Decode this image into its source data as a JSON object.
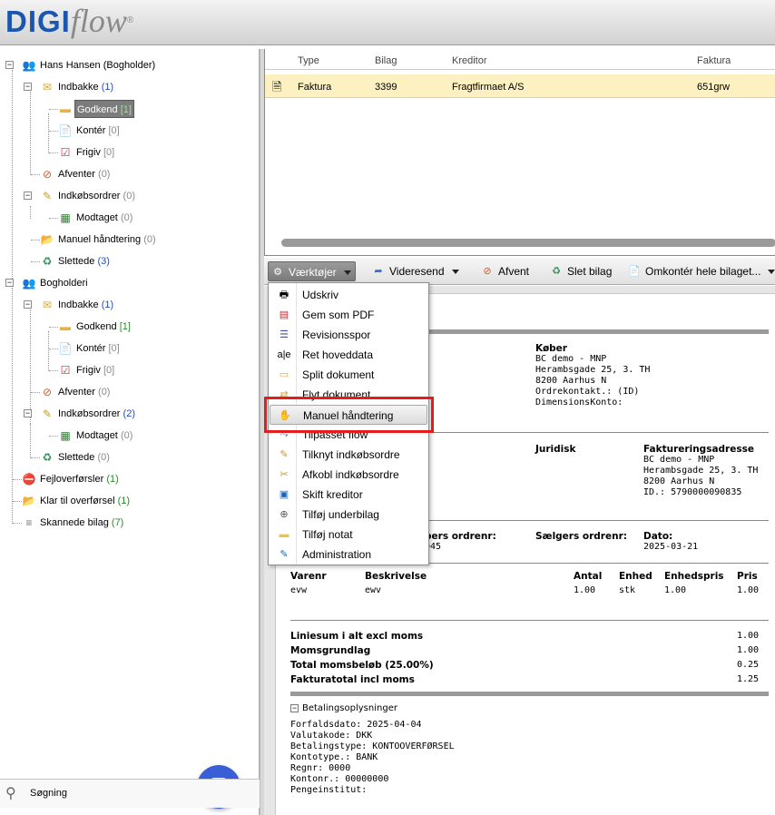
{
  "app": {
    "logo_a": "DIGI",
    "logo_b": "flow",
    "logo_mark": "®"
  },
  "tree": [
    {
      "label": "Hans Hansen (Bogholder)",
      "count": "",
      "icon": "user-group-icon",
      "sign": "−"
    },
    {
      "label": "Indbakke",
      "count": "(1)",
      "icon": "inbox-icon",
      "sign": "−"
    },
    {
      "label": "Godkend",
      "count": "[1]",
      "icon": "folder-icon"
    },
    {
      "label": "Kontér",
      "count": "[0]",
      "icon": "document-icon"
    },
    {
      "label": "Frigiv",
      "count": "[0]",
      "icon": "document-check-icon"
    },
    {
      "label": "Afventer",
      "count": "(0)",
      "icon": "folder-blocked-icon"
    },
    {
      "label": "Indkøbsordrer",
      "count": "(0)",
      "icon": "inbox-pencil-icon",
      "sign": "−"
    },
    {
      "label": "Modtaget",
      "count": "(0)",
      "icon": "money-icon"
    },
    {
      "label": "Manuel håndtering",
      "count": "(0)",
      "icon": "open-folder-icon"
    },
    {
      "label": "Slettede",
      "count": "(3)",
      "icon": "trash-icon"
    },
    {
      "label": "Bogholderi",
      "count": "",
      "icon": "user-group-icon",
      "sign": "−"
    },
    {
      "label": "Indbakke",
      "count": "(1)",
      "icon": "inbox-icon",
      "sign": "−"
    },
    {
      "label": "Godkend",
      "count": "[1]",
      "icon": "folder-icon"
    },
    {
      "label": "Kontér",
      "count": "[0]",
      "icon": "document-icon"
    },
    {
      "label": "Frigiv",
      "count": "[0]",
      "icon": "document-check-icon"
    },
    {
      "label": "Afventer",
      "count": "(0)",
      "icon": "folder-blocked-icon"
    },
    {
      "label": "Indkøbsordrer",
      "count": "(2)",
      "icon": "inbox-pencil-icon",
      "sign": "−"
    },
    {
      "label": "Modtaget",
      "count": "(0)",
      "icon": "money-icon"
    },
    {
      "label": "Slettede",
      "count": "(0)",
      "icon": "trash-icon"
    },
    {
      "label": "Fejloverførsler",
      "count": "(1)",
      "icon": "document-error-icon"
    },
    {
      "label": "Klar til overførsel",
      "count": "(1)",
      "icon": "open-folder-icon"
    },
    {
      "label": "Skannede bilag",
      "count": "(7)",
      "icon": "scanned-docs-icon"
    }
  ],
  "search": {
    "label": "Søgning"
  },
  "grid": {
    "headers": [
      "Type",
      "Bilag",
      "Kreditor",
      "Faktura"
    ],
    "row": {
      "type": "Faktura",
      "bilag": "3399",
      "kreditor": "Fragtfirmaet A/S",
      "faktura": "651grw"
    }
  },
  "toolbar": {
    "tools": "Værktøjer",
    "forward": "Videresend",
    "wait": "Afvent",
    "delete": "Slet bilag",
    "repost": "Omkontér hele bilaget..."
  },
  "menu": [
    {
      "label": "Udskriv",
      "icon": "printer-icon"
    },
    {
      "label": "Gem som PDF",
      "icon": "pdf-icon"
    },
    {
      "label": "Revisionsspor",
      "icon": "audit-trail-icon"
    },
    {
      "label": "Ret hoveddata",
      "icon": "edit-text-icon"
    },
    {
      "label": "Split dokument",
      "icon": "split-document-icon"
    },
    {
      "label": "Flyt dokument",
      "icon": "move-document-icon"
    },
    {
      "label": "Manuel håndtering",
      "icon": "manual-handling-icon"
    },
    {
      "label": "Tilpasset flow",
      "icon": "custom-flow-icon"
    },
    {
      "label": "Tilknyt indkøbsordre",
      "icon": "link-order-icon"
    },
    {
      "label": "Afkobl indkøbsordre",
      "icon": "unlink-order-icon"
    },
    {
      "label": "Skift kreditor",
      "icon": "change-creditor-icon"
    },
    {
      "label": "Tilføj underbilag",
      "icon": "add-attachment-icon"
    },
    {
      "label": "Tilføj notat",
      "icon": "note-icon"
    },
    {
      "label": "Administration",
      "icon": "administration-icon"
    }
  ],
  "document": {
    "buyer": {
      "title": "Køber",
      "lines": [
        "BC demo - MNP",
        "Herambsgade 25, 3. TH",
        "8200 Aarhus N",
        "Ordrekontakt.: (ID)",
        "DimensionsKonto:"
      ]
    },
    "legal": "Juridisk",
    "billing": {
      "title": "Faktureringsadresse",
      "lines": [
        "BC demo - MNP",
        "Herambsgade 25, 3. TH",
        "8200 Aarhus N",
        "ID.: 5790000090835"
      ]
    },
    "buyers_order": {
      "title": "bers ordrenr:",
      "value": "045"
    },
    "seller_order": {
      "title": "Sælgers ordrenr:"
    },
    "date": {
      "title": "Dato:",
      "value": "2025-03-21"
    },
    "lines_header": [
      "Varenr",
      "Beskrivelse",
      "Antal",
      "Enhed",
      "Enhedspris",
      "Pris"
    ],
    "line": [
      "evw",
      "ewv",
      "1.00",
      "stk",
      "1.00",
      "1.00"
    ],
    "totals": [
      {
        "label": "Liniesum i alt excl moms",
        "value": "1.00"
      },
      {
        "label": "Momsgrundlag",
        "value": "1.00"
      },
      {
        "label": "Total momsbeløb (25.00%)",
        "value": "0.25"
      },
      {
        "label": "Fakturatotal incl moms",
        "value": "1.25"
      }
    ],
    "payment": {
      "title": "Betalingsoplysninger",
      "toggle": "−",
      "lines": [
        "Forfaldsdato: 2025-04-04",
        "Valutakode: DKK",
        "Betalingstype: KONTOOVERFØRSEL",
        "Kontotype.: BANK",
        "Regnr: 0000",
        "Kontonr.: 00000000",
        "Pengeinstitut:"
      ]
    }
  }
}
